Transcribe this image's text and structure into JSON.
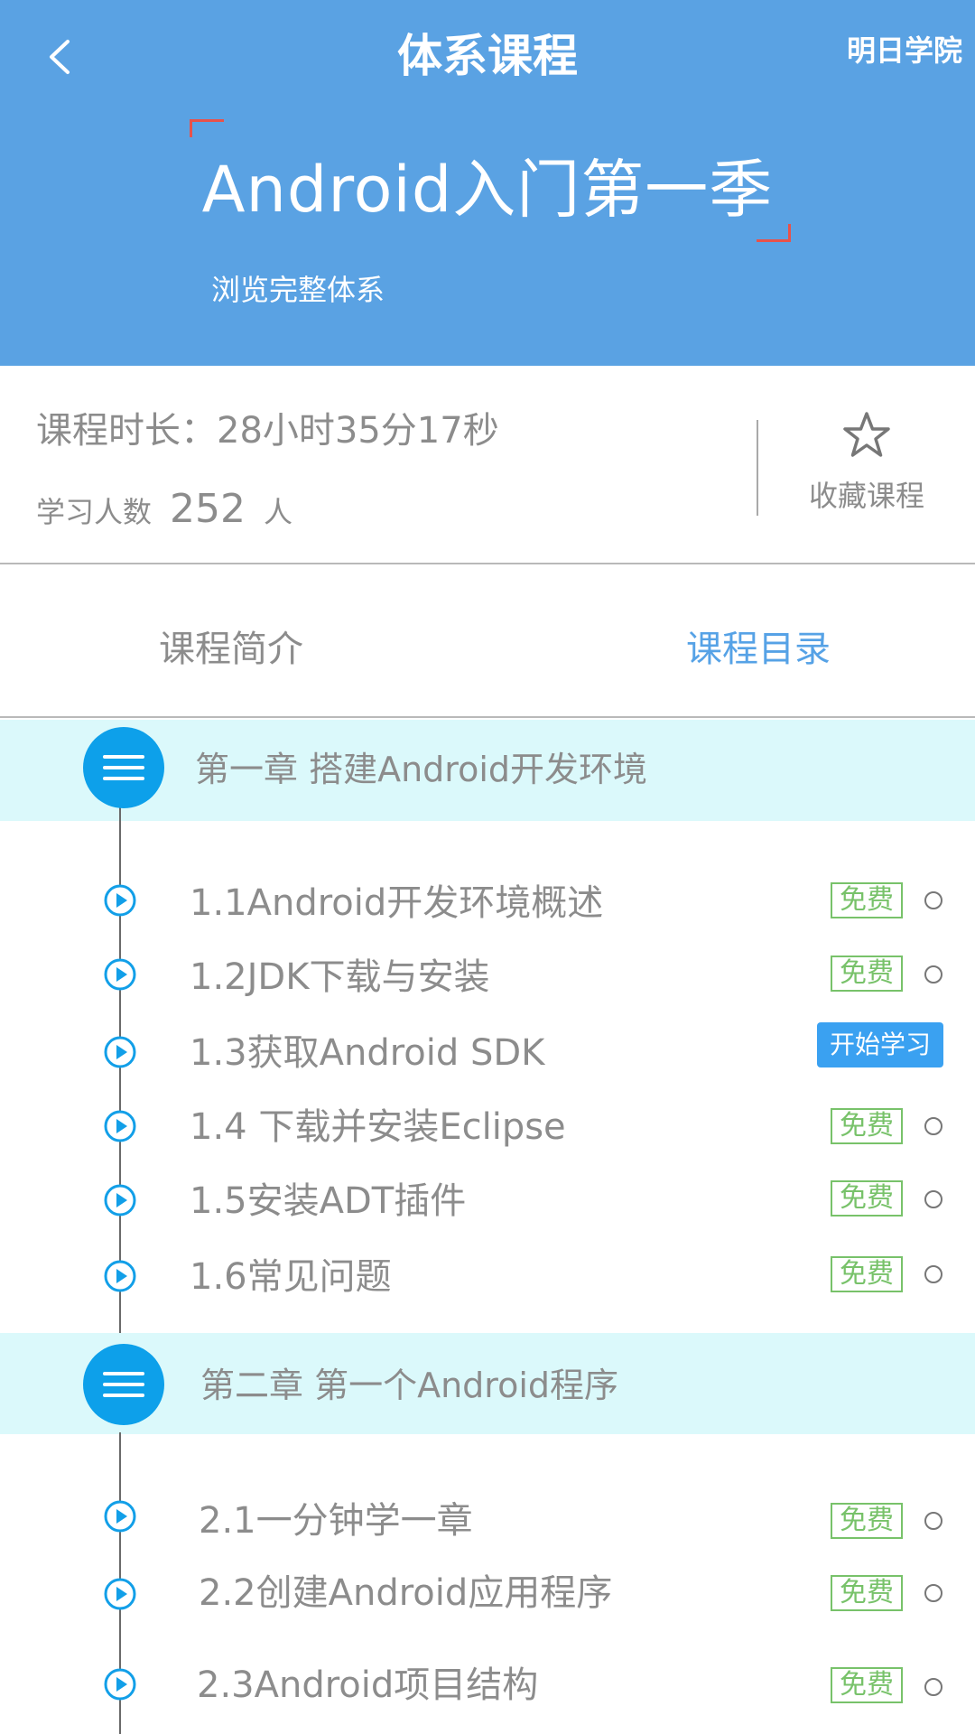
{
  "header": {
    "title": "体系课程",
    "brand": "明日学院",
    "course_name": "Android入门第一季",
    "browse_label": "浏览完整体系"
  },
  "info": {
    "duration": "课程时长：28小时35分17秒",
    "learners_label": "学习人数",
    "learners_count": "252",
    "learners_unit": "人",
    "favorite_label": "收藏课程"
  },
  "tabs": {
    "intro": "课程简介",
    "catalog": "课程目录"
  },
  "chapters": [
    {
      "title": "第一章 搭建Android开发环境",
      "lessons": [
        {
          "title": "1.1Android开发环境概述",
          "badge": "免费"
        },
        {
          "title": "1.2JDK下载与安装",
          "badge": "免费"
        },
        {
          "title": "1.3获取Android SDK",
          "action": "开始学习"
        },
        {
          "title": "1.4 下载并安装Eclipse",
          "badge": "免费"
        },
        {
          "title": "1.5安装ADT插件",
          "badge": "免费"
        },
        {
          "title": "1.6常见问题",
          "badge": "免费"
        }
      ]
    },
    {
      "title": "第二章 第一个Android程序",
      "lessons": [
        {
          "title": "2.1一分钟学一章",
          "badge": "免费"
        },
        {
          "title": "2.2创建Android应用程序",
          "badge": "免费"
        },
        {
          "title": "2.3Android项目结构",
          "badge": "免费"
        }
      ]
    }
  ],
  "colors": {
    "header_bg": "#5aa2e3",
    "accent": "#56a2e6",
    "chapter_bg": "#dbf9fb",
    "free_badge": "#78c26a",
    "start_button": "#3aa1f1"
  }
}
